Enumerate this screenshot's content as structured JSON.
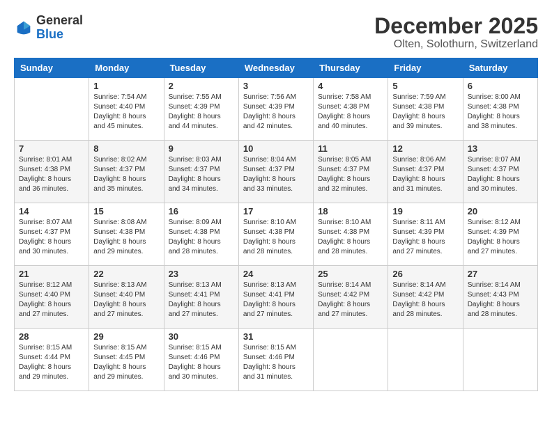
{
  "logo": {
    "general": "General",
    "blue": "Blue"
  },
  "header": {
    "month": "December 2025",
    "location": "Olten, Solothurn, Switzerland"
  },
  "weekdays": [
    "Sunday",
    "Monday",
    "Tuesday",
    "Wednesday",
    "Thursday",
    "Friday",
    "Saturday"
  ],
  "weeks": [
    [
      null,
      {
        "day": "1",
        "sunrise": "7:54 AM",
        "sunset": "4:40 PM",
        "daylight": "8 hours and 45 minutes."
      },
      {
        "day": "2",
        "sunrise": "7:55 AM",
        "sunset": "4:39 PM",
        "daylight": "8 hours and 44 minutes."
      },
      {
        "day": "3",
        "sunrise": "7:56 AM",
        "sunset": "4:39 PM",
        "daylight": "8 hours and 42 minutes."
      },
      {
        "day": "4",
        "sunrise": "7:58 AM",
        "sunset": "4:38 PM",
        "daylight": "8 hours and 40 minutes."
      },
      {
        "day": "5",
        "sunrise": "7:59 AM",
        "sunset": "4:38 PM",
        "daylight": "8 hours and 39 minutes."
      },
      {
        "day": "6",
        "sunrise": "8:00 AM",
        "sunset": "4:38 PM",
        "daylight": "8 hours and 38 minutes."
      }
    ],
    [
      {
        "day": "7",
        "sunrise": "8:01 AM",
        "sunset": "4:38 PM",
        "daylight": "8 hours and 36 minutes."
      },
      {
        "day": "8",
        "sunrise": "8:02 AM",
        "sunset": "4:37 PM",
        "daylight": "8 hours and 35 minutes."
      },
      {
        "day": "9",
        "sunrise": "8:03 AM",
        "sunset": "4:37 PM",
        "daylight": "8 hours and 34 minutes."
      },
      {
        "day": "10",
        "sunrise": "8:04 AM",
        "sunset": "4:37 PM",
        "daylight": "8 hours and 33 minutes."
      },
      {
        "day": "11",
        "sunrise": "8:05 AM",
        "sunset": "4:37 PM",
        "daylight": "8 hours and 32 minutes."
      },
      {
        "day": "12",
        "sunrise": "8:06 AM",
        "sunset": "4:37 PM",
        "daylight": "8 hours and 31 minutes."
      },
      {
        "day": "13",
        "sunrise": "8:07 AM",
        "sunset": "4:37 PM",
        "daylight": "8 hours and 30 minutes."
      }
    ],
    [
      {
        "day": "14",
        "sunrise": "8:07 AM",
        "sunset": "4:37 PM",
        "daylight": "8 hours and 30 minutes."
      },
      {
        "day": "15",
        "sunrise": "8:08 AM",
        "sunset": "4:38 PM",
        "daylight": "8 hours and 29 minutes."
      },
      {
        "day": "16",
        "sunrise": "8:09 AM",
        "sunset": "4:38 PM",
        "daylight": "8 hours and 28 minutes."
      },
      {
        "day": "17",
        "sunrise": "8:10 AM",
        "sunset": "4:38 PM",
        "daylight": "8 hours and 28 minutes."
      },
      {
        "day": "18",
        "sunrise": "8:10 AM",
        "sunset": "4:38 PM",
        "daylight": "8 hours and 28 minutes."
      },
      {
        "day": "19",
        "sunrise": "8:11 AM",
        "sunset": "4:39 PM",
        "daylight": "8 hours and 27 minutes."
      },
      {
        "day": "20",
        "sunrise": "8:12 AM",
        "sunset": "4:39 PM",
        "daylight": "8 hours and 27 minutes."
      }
    ],
    [
      {
        "day": "21",
        "sunrise": "8:12 AM",
        "sunset": "4:40 PM",
        "daylight": "8 hours and 27 minutes."
      },
      {
        "day": "22",
        "sunrise": "8:13 AM",
        "sunset": "4:40 PM",
        "daylight": "8 hours and 27 minutes."
      },
      {
        "day": "23",
        "sunrise": "8:13 AM",
        "sunset": "4:41 PM",
        "daylight": "8 hours and 27 minutes."
      },
      {
        "day": "24",
        "sunrise": "8:13 AM",
        "sunset": "4:41 PM",
        "daylight": "8 hours and 27 minutes."
      },
      {
        "day": "25",
        "sunrise": "8:14 AM",
        "sunset": "4:42 PM",
        "daylight": "8 hours and 27 minutes."
      },
      {
        "day": "26",
        "sunrise": "8:14 AM",
        "sunset": "4:42 PM",
        "daylight": "8 hours and 28 minutes."
      },
      {
        "day": "27",
        "sunrise": "8:14 AM",
        "sunset": "4:43 PM",
        "daylight": "8 hours and 28 minutes."
      }
    ],
    [
      {
        "day": "28",
        "sunrise": "8:15 AM",
        "sunset": "4:44 PM",
        "daylight": "8 hours and 29 minutes."
      },
      {
        "day": "29",
        "sunrise": "8:15 AM",
        "sunset": "4:45 PM",
        "daylight": "8 hours and 29 minutes."
      },
      {
        "day": "30",
        "sunrise": "8:15 AM",
        "sunset": "4:46 PM",
        "daylight": "8 hours and 30 minutes."
      },
      {
        "day": "31",
        "sunrise": "8:15 AM",
        "sunset": "4:46 PM",
        "daylight": "8 hours and 31 minutes."
      },
      null,
      null,
      null
    ]
  ]
}
